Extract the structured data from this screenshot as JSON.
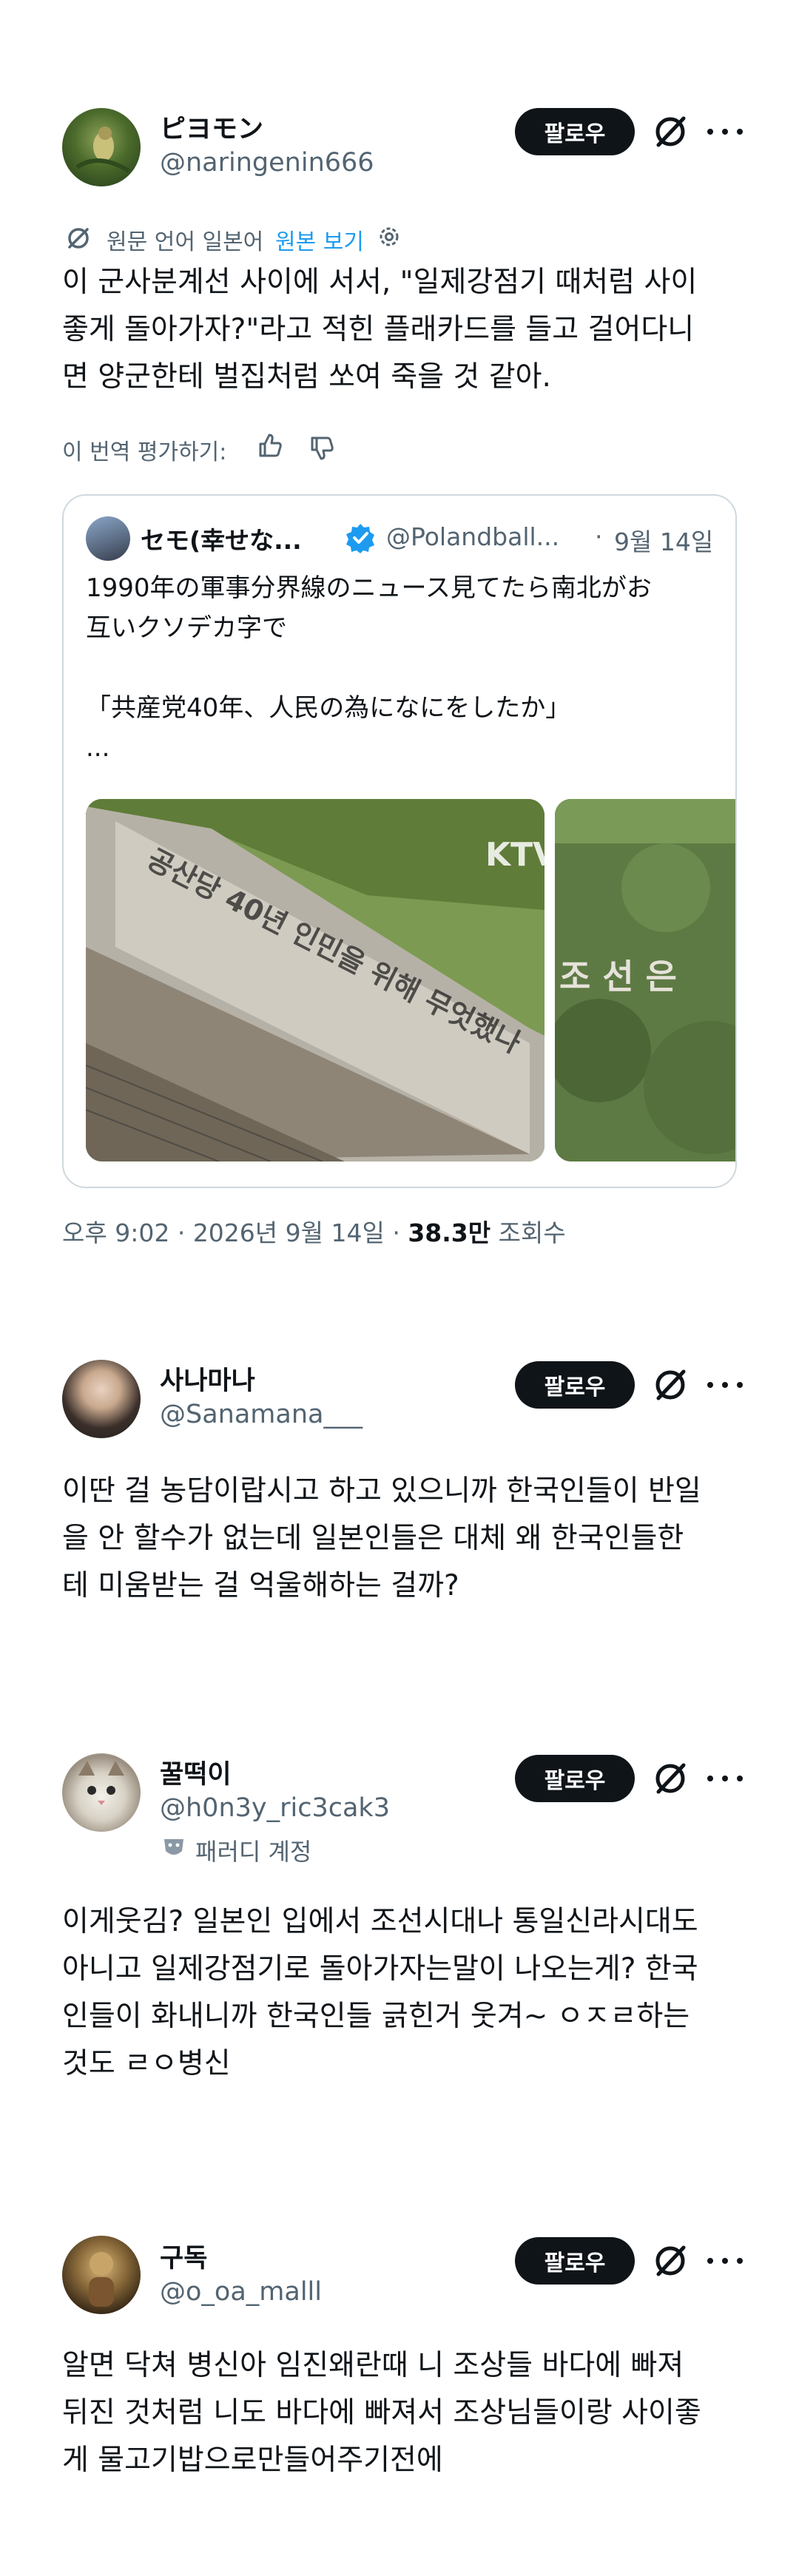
{
  "tweet": {
    "author_name": "ピヨモン",
    "author_handle": "@naringenin666",
    "follow_label": "팔로우",
    "translate_prefix": "원문 언어 일본어",
    "translate_link": "원본 보기",
    "body_lines": [
      "이 군사분계선 사이에 서서, \"일제강점기 때처럼 사이",
      "좋게 돌아가자?\"라고 적힌 플래카드를 들고 걸어다니",
      "면 양군한테 벌집처럼 쏘여 죽을 것 같아."
    ],
    "rate_label": "이 번역 평가하기:",
    "quote": {
      "name": "セモ(幸せな...",
      "handle": "@Polandball...",
      "separator": "·",
      "date": "9월 14일",
      "lines": [
        "1990年の軍事分界線のニュース見てたら南北がお",
        "互いクソデカ字で",
        "",
        "「共産党40年、人民の為になにをしたか」",
        "..."
      ],
      "image1_watermark": "KTV",
      "image1_wall_text": "공산당 40년 인민을 위해 무엇했나",
      "image2_text": "조 선 은"
    },
    "time": "오후 9:02",
    "date": "2026년 9월 14일",
    "views": "38.3만",
    "views_label": "조회수"
  },
  "replies": [
    {
      "name": "사나마나",
      "handle": "@Sanamana___",
      "follow_label": "팔로우",
      "lines": [
        "이딴 걸 농담이랍시고 하고 있으니까 한국인들이 반일",
        "을 안 할수가 없는데 일본인들은 대체 왜 한국인들한",
        "테 미움받는 걸 억울해하는 걸까?"
      ]
    },
    {
      "name": "꿀떡이",
      "handle": "@h0n3y_ric3cak3",
      "badge": "패러디 계정",
      "follow_label": "팔로우",
      "lines": [
        "이게웃김? 일본인 입에서 조선시대나 통일신라시대도",
        "아니고 일제강점기로 돌아가자는말이 나오는게? 한국",
        "인들이 화내니까 한국인들 긁힌거 웃겨~ ㅇㅈㄹ하는",
        "것도 ㄹㅇ병신"
      ]
    },
    {
      "name": "구독",
      "handle": "@o_oa_malll",
      "follow_label": "팔로우",
      "lines": [
        "알면 닥쳐 병신아 임진왜란때 니 조상들 바다에 빠져",
        "뒤진 것처럼 니도 바다에 빠져서 조상님들이랑 사이좋",
        "게 물고기밥으로만들어주기전에"
      ]
    }
  ]
}
